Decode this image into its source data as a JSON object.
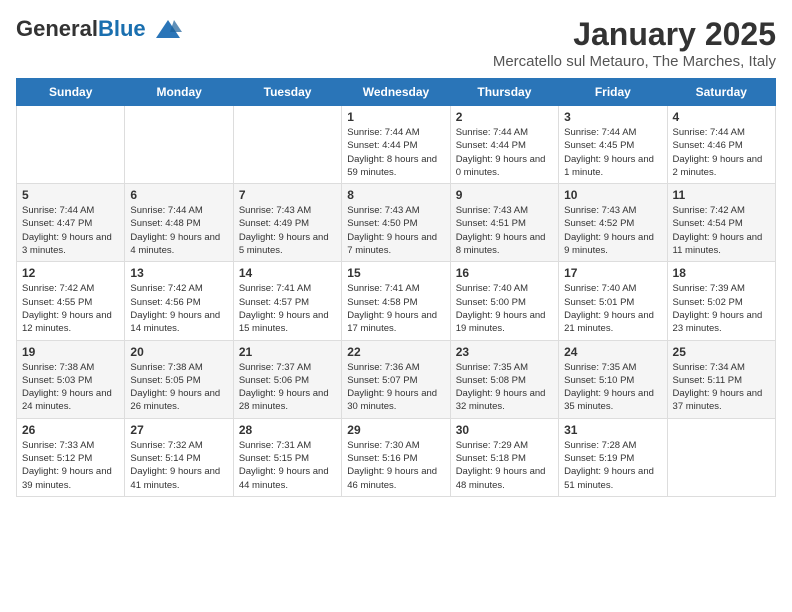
{
  "logo": {
    "general": "General",
    "blue": "Blue"
  },
  "header": {
    "month_title": "January 2025",
    "location": "Mercatello sul Metauro, The Marches, Italy"
  },
  "weekdays": [
    "Sunday",
    "Monday",
    "Tuesday",
    "Wednesday",
    "Thursday",
    "Friday",
    "Saturday"
  ],
  "weeks": [
    [
      {
        "day": "",
        "info": ""
      },
      {
        "day": "",
        "info": ""
      },
      {
        "day": "",
        "info": ""
      },
      {
        "day": "1",
        "info": "Sunrise: 7:44 AM\nSunset: 4:44 PM\nDaylight: 8 hours and 59 minutes."
      },
      {
        "day": "2",
        "info": "Sunrise: 7:44 AM\nSunset: 4:44 PM\nDaylight: 9 hours and 0 minutes."
      },
      {
        "day": "3",
        "info": "Sunrise: 7:44 AM\nSunset: 4:45 PM\nDaylight: 9 hours and 1 minute."
      },
      {
        "day": "4",
        "info": "Sunrise: 7:44 AM\nSunset: 4:46 PM\nDaylight: 9 hours and 2 minutes."
      }
    ],
    [
      {
        "day": "5",
        "info": "Sunrise: 7:44 AM\nSunset: 4:47 PM\nDaylight: 9 hours and 3 minutes."
      },
      {
        "day": "6",
        "info": "Sunrise: 7:44 AM\nSunset: 4:48 PM\nDaylight: 9 hours and 4 minutes."
      },
      {
        "day": "7",
        "info": "Sunrise: 7:43 AM\nSunset: 4:49 PM\nDaylight: 9 hours and 5 minutes."
      },
      {
        "day": "8",
        "info": "Sunrise: 7:43 AM\nSunset: 4:50 PM\nDaylight: 9 hours and 7 minutes."
      },
      {
        "day": "9",
        "info": "Sunrise: 7:43 AM\nSunset: 4:51 PM\nDaylight: 9 hours and 8 minutes."
      },
      {
        "day": "10",
        "info": "Sunrise: 7:43 AM\nSunset: 4:52 PM\nDaylight: 9 hours and 9 minutes."
      },
      {
        "day": "11",
        "info": "Sunrise: 7:42 AM\nSunset: 4:54 PM\nDaylight: 9 hours and 11 minutes."
      }
    ],
    [
      {
        "day": "12",
        "info": "Sunrise: 7:42 AM\nSunset: 4:55 PM\nDaylight: 9 hours and 12 minutes."
      },
      {
        "day": "13",
        "info": "Sunrise: 7:42 AM\nSunset: 4:56 PM\nDaylight: 9 hours and 14 minutes."
      },
      {
        "day": "14",
        "info": "Sunrise: 7:41 AM\nSunset: 4:57 PM\nDaylight: 9 hours and 15 minutes."
      },
      {
        "day": "15",
        "info": "Sunrise: 7:41 AM\nSunset: 4:58 PM\nDaylight: 9 hours and 17 minutes."
      },
      {
        "day": "16",
        "info": "Sunrise: 7:40 AM\nSunset: 5:00 PM\nDaylight: 9 hours and 19 minutes."
      },
      {
        "day": "17",
        "info": "Sunrise: 7:40 AM\nSunset: 5:01 PM\nDaylight: 9 hours and 21 minutes."
      },
      {
        "day": "18",
        "info": "Sunrise: 7:39 AM\nSunset: 5:02 PM\nDaylight: 9 hours and 23 minutes."
      }
    ],
    [
      {
        "day": "19",
        "info": "Sunrise: 7:38 AM\nSunset: 5:03 PM\nDaylight: 9 hours and 24 minutes."
      },
      {
        "day": "20",
        "info": "Sunrise: 7:38 AM\nSunset: 5:05 PM\nDaylight: 9 hours and 26 minutes."
      },
      {
        "day": "21",
        "info": "Sunrise: 7:37 AM\nSunset: 5:06 PM\nDaylight: 9 hours and 28 minutes."
      },
      {
        "day": "22",
        "info": "Sunrise: 7:36 AM\nSunset: 5:07 PM\nDaylight: 9 hours and 30 minutes."
      },
      {
        "day": "23",
        "info": "Sunrise: 7:35 AM\nSunset: 5:08 PM\nDaylight: 9 hours and 32 minutes."
      },
      {
        "day": "24",
        "info": "Sunrise: 7:35 AM\nSunset: 5:10 PM\nDaylight: 9 hours and 35 minutes."
      },
      {
        "day": "25",
        "info": "Sunrise: 7:34 AM\nSunset: 5:11 PM\nDaylight: 9 hours and 37 minutes."
      }
    ],
    [
      {
        "day": "26",
        "info": "Sunrise: 7:33 AM\nSunset: 5:12 PM\nDaylight: 9 hours and 39 minutes."
      },
      {
        "day": "27",
        "info": "Sunrise: 7:32 AM\nSunset: 5:14 PM\nDaylight: 9 hours and 41 minutes."
      },
      {
        "day": "28",
        "info": "Sunrise: 7:31 AM\nSunset: 5:15 PM\nDaylight: 9 hours and 44 minutes."
      },
      {
        "day": "29",
        "info": "Sunrise: 7:30 AM\nSunset: 5:16 PM\nDaylight: 9 hours and 46 minutes."
      },
      {
        "day": "30",
        "info": "Sunrise: 7:29 AM\nSunset: 5:18 PM\nDaylight: 9 hours and 48 minutes."
      },
      {
        "day": "31",
        "info": "Sunrise: 7:28 AM\nSunset: 5:19 PM\nDaylight: 9 hours and 51 minutes."
      },
      {
        "day": "",
        "info": ""
      }
    ]
  ]
}
